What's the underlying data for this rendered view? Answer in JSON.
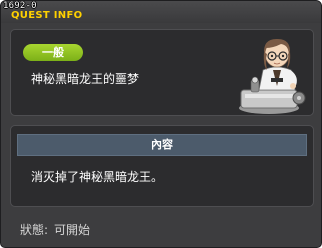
{
  "window": {
    "quest_id": "1692-0",
    "title": "QUEST INFO"
  },
  "quest": {
    "category": "一般",
    "name": "神秘黑暗龙王的噩梦",
    "npc_icon": "npc-portrait-scientist"
  },
  "content": {
    "header": "內容",
    "text": "消灭掉了神秘黑暗龙王。"
  },
  "status": {
    "label": "狀態:",
    "value": "可開始"
  },
  "colors": {
    "title_accent": "#ffd100",
    "badge_green": "#8cc21e",
    "content_header": "#4c5b6b",
    "window_bg": "#3d3d3f"
  }
}
